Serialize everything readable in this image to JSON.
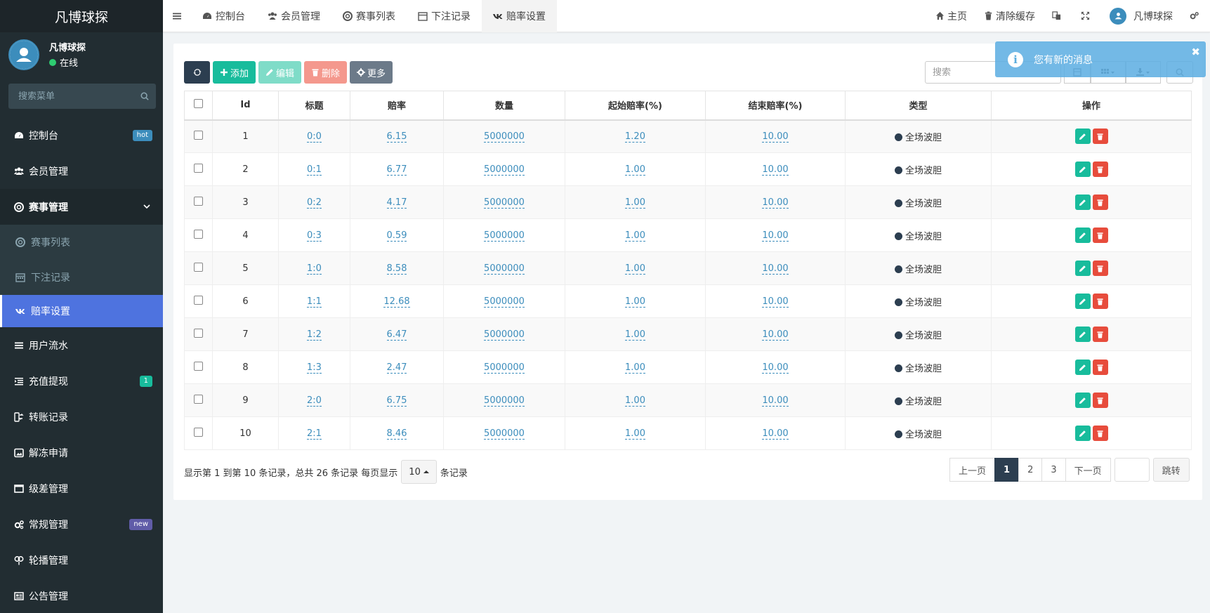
{
  "brand": "凡博球探",
  "user": {
    "name": "凡博球探",
    "status": "在线"
  },
  "sidebar": {
    "search_placeholder": "搜索菜单",
    "items": [
      {
        "label": "控制台",
        "icon": "dashboard-icon",
        "badge": "hot"
      },
      {
        "label": "会员管理",
        "icon": "users-icon"
      },
      {
        "label": "赛事管理",
        "icon": "lifebuoy-icon"
      },
      {
        "label": "赛事列表",
        "icon": "lifebuoy-icon"
      },
      {
        "label": "下注记录",
        "icon": "calendar-icon"
      },
      {
        "label": "赔率设置",
        "icon": "vk-icon"
      },
      {
        "label": "用户流水",
        "icon": "list-icon"
      },
      {
        "label": "充值提现",
        "icon": "indent-icon",
        "badge": "1"
      },
      {
        "label": "转账记录",
        "icon": "exchange-icon"
      },
      {
        "label": "解冻申请",
        "icon": "image-icon"
      },
      {
        "label": "级差管理",
        "icon": "window-icon"
      },
      {
        "label": "常规管理",
        "icon": "cogs-icon",
        "badge": "new"
      },
      {
        "label": "轮播管理",
        "icon": "balloon-icon"
      },
      {
        "label": "公告管理",
        "icon": "newspaper-icon"
      }
    ]
  },
  "navbar": {
    "tabs": [
      "控制台",
      "会员管理",
      "赛事列表",
      "下注记录",
      "赔率设置"
    ],
    "home": "主页",
    "clear_cache": "清除缓存",
    "username": "凡博球探"
  },
  "toolbar": {
    "add": "添加",
    "edit": "编辑",
    "delete": "删除",
    "more": "更多",
    "search_placeholder": "搜索"
  },
  "table": {
    "headers": [
      "Id",
      "标题",
      "赔率",
      "数量",
      "起始赔率(%)",
      "结束赔率(%)",
      "类型",
      "操作"
    ],
    "rows": [
      {
        "id": "1",
        "title": "0:0",
        "odds": "6.15",
        "qty": "5000000",
        "start": "1.20",
        "end": "10.00",
        "type": "全场波胆"
      },
      {
        "id": "2",
        "title": "0:1",
        "odds": "6.77",
        "qty": "5000000",
        "start": "1.00",
        "end": "10.00",
        "type": "全场波胆"
      },
      {
        "id": "3",
        "title": "0:2",
        "odds": "4.17",
        "qty": "5000000",
        "start": "1.00",
        "end": "10.00",
        "type": "全场波胆"
      },
      {
        "id": "4",
        "title": "0:3",
        "odds": "0.59",
        "qty": "5000000",
        "start": "1.00",
        "end": "10.00",
        "type": "全场波胆"
      },
      {
        "id": "5",
        "title": "1:0",
        "odds": "8.58",
        "qty": "5000000",
        "start": "1.00",
        "end": "10.00",
        "type": "全场波胆"
      },
      {
        "id": "6",
        "title": "1:1",
        "odds": "12.68",
        "qty": "5000000",
        "start": "1.00",
        "end": "10.00",
        "type": "全场波胆"
      },
      {
        "id": "7",
        "title": "1:2",
        "odds": "6.47",
        "qty": "5000000",
        "start": "1.00",
        "end": "10.00",
        "type": "全场波胆"
      },
      {
        "id": "8",
        "title": "1:3",
        "odds": "2.47",
        "qty": "5000000",
        "start": "1.00",
        "end": "10.00",
        "type": "全场波胆"
      },
      {
        "id": "9",
        "title": "2:0",
        "odds": "6.75",
        "qty": "5000000",
        "start": "1.00",
        "end": "10.00",
        "type": "全场波胆"
      },
      {
        "id": "10",
        "title": "2:1",
        "odds": "8.46",
        "qty": "5000000",
        "start": "1.00",
        "end": "10.00",
        "type": "全场波胆"
      }
    ]
  },
  "footer": {
    "info": "显示第 1 到第 10 条记录，总共 26 条记录 每页显示",
    "page_size": "10",
    "suffix": "条记录",
    "prev": "上一页",
    "pages": [
      "1",
      "2",
      "3"
    ],
    "next": "下一页",
    "go": "跳转"
  },
  "toast": {
    "message": "您有新的消息"
  },
  "colors": {
    "sidebar": "#222d32",
    "active": "#4e73df",
    "primary": "#18bc9c",
    "danger": "#e74c3c",
    "dark": "#2c3e50"
  }
}
